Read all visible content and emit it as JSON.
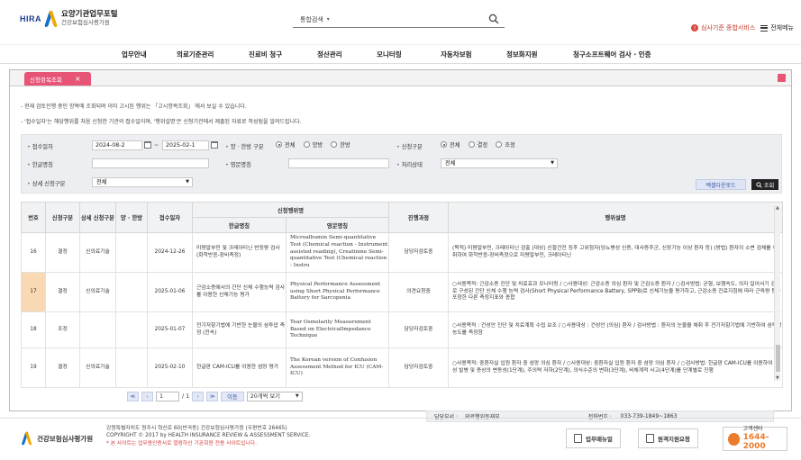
{
  "header": {
    "logo_hira": "HIRA",
    "logo_title": "요양기관업무포털",
    "logo_sub": "건강보험심사평가원",
    "search_select": "통합검색",
    "criteria_link": "심사기준 종합서비스",
    "menu_link": "전체메뉴"
  },
  "gnb": [
    "업무안내",
    "의료기준관리",
    "진료비 청구",
    "정산관리",
    "모니터링",
    "자동차보험",
    "정보화지원",
    "청구소프트웨어 검사 · 인증"
  ],
  "tab": {
    "label": "신청항목조회"
  },
  "notices": [
    "- 현재 검토진행 중인 항목에 조회되며 이미 고시된 행위는 「고시항목조회」 에서 보실 수 있습니다.",
    "- '접수일자'는 해당행위를 처음 신청한 기관의 접수일이며, '행위설명'은 신청기관에서 제출된 자료로 작성됨을 알려드립니다."
  ],
  "filter": {
    "date_label": "접수일자",
    "date_from": "2024-08-2",
    "date_tilde": "~",
    "date_to": "2025-02-1",
    "type_label": "양 · 한방 구분",
    "type_options": [
      "전체",
      "양방",
      "한방"
    ],
    "apply_label": "신청구분",
    "apply_options": [
      "전체",
      "결정",
      "조정"
    ],
    "kor_label": "한글명칭",
    "eng_label": "영문명칭",
    "status_label": "처리상태",
    "status_value": "전체",
    "detail_label": "상세 신청구분",
    "detail_value": "전체",
    "excel_button": "엑셀다운로드",
    "search_button": "조회"
  },
  "table": {
    "headers": {
      "no": "번호",
      "apply_type": "신청구분",
      "detail_type": "상세 신청구분",
      "med_type": "양 · 한방",
      "date": "접수일자",
      "group": "신청행위명",
      "kor": "한글명칭",
      "eng": "영문명칭",
      "progress": "진행과정",
      "desc": "행위설명"
    },
    "rows": [
      {
        "no": "16",
        "apply_type": "결정",
        "detail_type": "신의료기술",
        "med_type": "",
        "date": "2024-12-26",
        "kor": "미량알부민 및 크레아티닌 반정량 검사 (화학반응-장비측정)",
        "eng": "Microalbumin Semi-quantitative Test (Chemical reaction ‐ Instrument assisted reading), Creatinine Semi-quantitative Test (Chemical reaction ‐ Instru",
        "progress": "담당자검토중",
        "desc": "(목적) 미량알부민, 크레아티닌 검출 (대상) 신할건전 징후 고위험자(당뇨병성 신증, 대사증후군, 신장기능 이상 환자 등) (방법) 환자의 소변 검체를 채취하여 화학반응-장비측정으로 미량알부민, 크레아티닌"
      },
      {
        "no": "17",
        "apply_type": "결정",
        "detail_type": "신의료기술",
        "med_type": "",
        "date": "2025-01-06",
        "kor": "근감소증에서의 간단 신체 수행능력 검사를 이용한 신체기능 평가",
        "eng": "Physical Performance Assessment using Short Physical Performance Battery for Sarcopenia",
        "progress": "의견요청중",
        "desc": "○사용목적: 근감소증 진단 및 치료효과 모니터링 / ○사용대상: 근감소증 의심 환자 및 근감소증 환자 / ○검사방법: 균형, 보행속도, 의자 일어서기 검사로 구성된 간단 신체 수행 능력 검사(Short Physical Performance Battery, SPPB)로 신체기능을 평가하고, 근감소증 진료지침에 따라 근육량 등을 포함한 다른 측정지표와 종합"
      },
      {
        "no": "18",
        "apply_type": "조정",
        "detail_type": "",
        "med_type": "",
        "date": "2025-01-07",
        "kor": "전기저항기법에 기반한 눈물의 삼투압 측정 (전속)",
        "eng": "Tear Osmolarity Measurement Based on ElectricalImpedance Technique",
        "progress": "담당자검토중",
        "desc": "○사용목적 : 건성안 진단 및 치료계획 수립 보조 / ○사용대상 : 건성안 (의심) 환자 / 검사방법 : 환자의 눈물을 채취 후 전기저항기법에 기반하여 삼투압 농도를 측정함"
      },
      {
        "no": "19",
        "apply_type": "결정",
        "detail_type": "신의료기술",
        "med_type": "",
        "date": "2025-02-10",
        "kor": "한글판 CAM-ICU를 이용한 섬망 평가",
        "eng": "The Korean version of Confusion Assessment Method for ICU (CAM-ICU)",
        "progress": "담당자검토중",
        "desc": "○사용목적: 중환자실 입원 환자 중 섬망 의심 환자 / ○사용대상: 중환자실 입원 환자 중 섬망 의심 환자 / ○검사방법: 한글판 CAM-ICU를 이용하여 급성 발병 및 증상의 변동성(1단계), 주의력 저하(2단계), 의식수준의 변화(3단계), 비체계적 사고(4단계)를 단계별로 진행"
      }
    ]
  },
  "pager": {
    "first": "≪",
    "prev": "‹",
    "page": "1",
    "total": "/ 1",
    "next": "›",
    "last": "≫",
    "go": "이동",
    "page_size": "20개씩 보기"
  },
  "contact": {
    "dept_label": "담당부서 :",
    "dept_value": "의료행위등재부",
    "phone_label": "전화번호 :",
    "phone_value": "033-739-1849~1863"
  },
  "footer": {
    "logo_text": "건강보험심사평가원",
    "address": "강원특별자치도 원주시 혁신로 60(반곡동) 건강보험심사평가원 (우편번호 26465)",
    "copyright": "COPYRIGHT © 2017 by HEALTH INSURANCE REVIEW & ASSESSMENT SERVICE.",
    "warning": "* 본 사이트는 업무용인증서로 열람하신 기관회원 전용 사이트입니다.",
    "btn_manual": "업무매뉴얼",
    "btn_remote": "원격지원요청",
    "call_label": "고객센터",
    "call_number": "1644-2000"
  },
  "colors": {
    "tab": "#e75476",
    "accent_blue": "#1b3f8f",
    "highlight_row": "#f8d9b3",
    "call": "#ec7b2c"
  }
}
